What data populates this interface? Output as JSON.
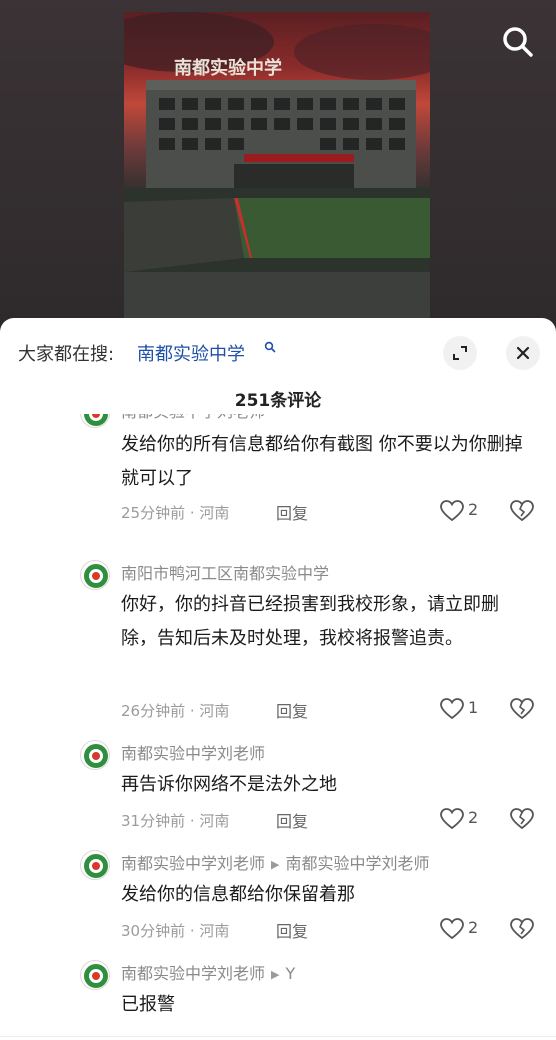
{
  "video": {
    "sign_text": "南都实验中学"
  },
  "search_icon": "search-icon",
  "header": {
    "hot_search_label": "大家都在搜:",
    "hot_search_term": "南都实验中学",
    "expand_icon": "expand-icon",
    "close_icon": "close-icon"
  },
  "comment_count": "251条评论",
  "comments": [
    {
      "username": "南都实验中学刘老师",
      "text": "发给你的所有信息都给你有截图 你不要以为你删掉就可以了",
      "time": "25分钟前 · 河南",
      "reply_label": "回复",
      "likes": "2"
    },
    {
      "username": "南阳市鸭河工区南都实验中学",
      "text": "你好，你的抖音已经损害到我校形象，请立即删除，告知后未及时处理，我校将报警追责。",
      "time": "26分钟前 · 河南",
      "reply_label": "回复",
      "likes": "1"
    },
    {
      "username": "南都实验中学刘老师",
      "text": "再告诉你网络不是法外之地",
      "time": "31分钟前 · 河南",
      "reply_label": "回复",
      "likes": "2"
    },
    {
      "username": "南都实验中学刘老师",
      "reply_to": "南都实验中学刘老师",
      "text": "发给你的信息都给你保留着那",
      "time": "30分钟前 · 河南",
      "reply_label": "回复",
      "likes": "2"
    },
    {
      "username": "南都实验中学刘老师",
      "reply_to": "Y",
      "text": "已报警"
    }
  ]
}
